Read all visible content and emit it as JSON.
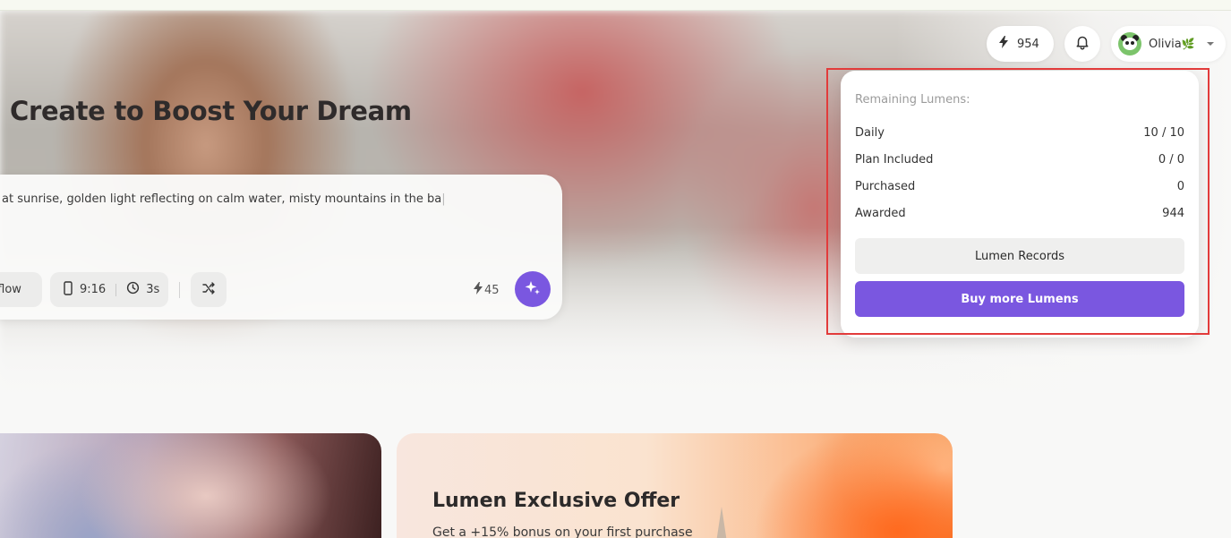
{
  "header": {
    "lumens_count": "954",
    "user_name": "Olivia",
    "user_badge": "🌿"
  },
  "hero": {
    "title": "Create to Boost Your Dream",
    "prompt_text": "at sunrise, golden light reflecting on calm water, misty mountains in the ba",
    "workflow_chip": "cflow",
    "aspect_ratio": "9:16",
    "duration": "3s",
    "cost": "45"
  },
  "popover": {
    "heading": "Remaining Lumens:",
    "rows": [
      {
        "label": "Daily",
        "value": "10 / 10"
      },
      {
        "label": "Plan Included",
        "value": "0 / 0"
      },
      {
        "label": "Purchased",
        "value": "0"
      },
      {
        "label": "Awarded",
        "value": "944"
      }
    ],
    "records_button": "Lumen Records",
    "buy_button": "Buy more Lumens"
  },
  "offer": {
    "title": "Lumen Exclusive Offer",
    "subtitle": "Get a +15% bonus on your first purchase"
  },
  "colors": {
    "accent": "#7a57e0",
    "highlight_border": "#e23b3b"
  },
  "icons": [
    "bolt-icon",
    "bell-icon",
    "chevron-down-icon",
    "phone-icon",
    "clock-icon",
    "shuffle-icon",
    "sparkle-icon"
  ]
}
